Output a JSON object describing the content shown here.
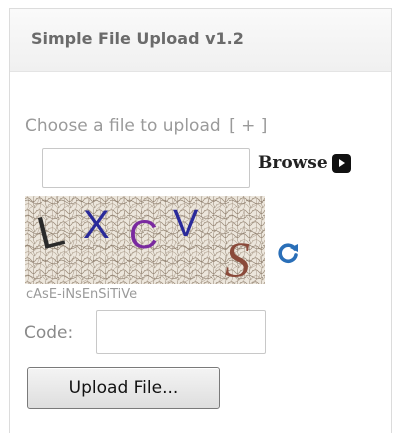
{
  "panel": {
    "title": "Simple File Upload v1.2"
  },
  "upload": {
    "choose_label": "Choose a file to upload",
    "add_link": "[ + ]",
    "file_value": "",
    "browse_label": "Browse"
  },
  "captcha": {
    "letters": [
      "L",
      "X",
      "C",
      "V",
      "S"
    ],
    "letter_colors": [
      "#2a2a2a",
      "#2a2a9a",
      "#7a2aa0",
      "#2a2a9a",
      "#8a4a3a"
    ],
    "hint": "cAsE-iNsEnSiTiVe",
    "code_label": "Code:",
    "code_value": "",
    "refresh_icon": "refresh-icon",
    "refresh_color": "#2a6fb8"
  },
  "actions": {
    "upload_button_label": "Upload File..."
  }
}
